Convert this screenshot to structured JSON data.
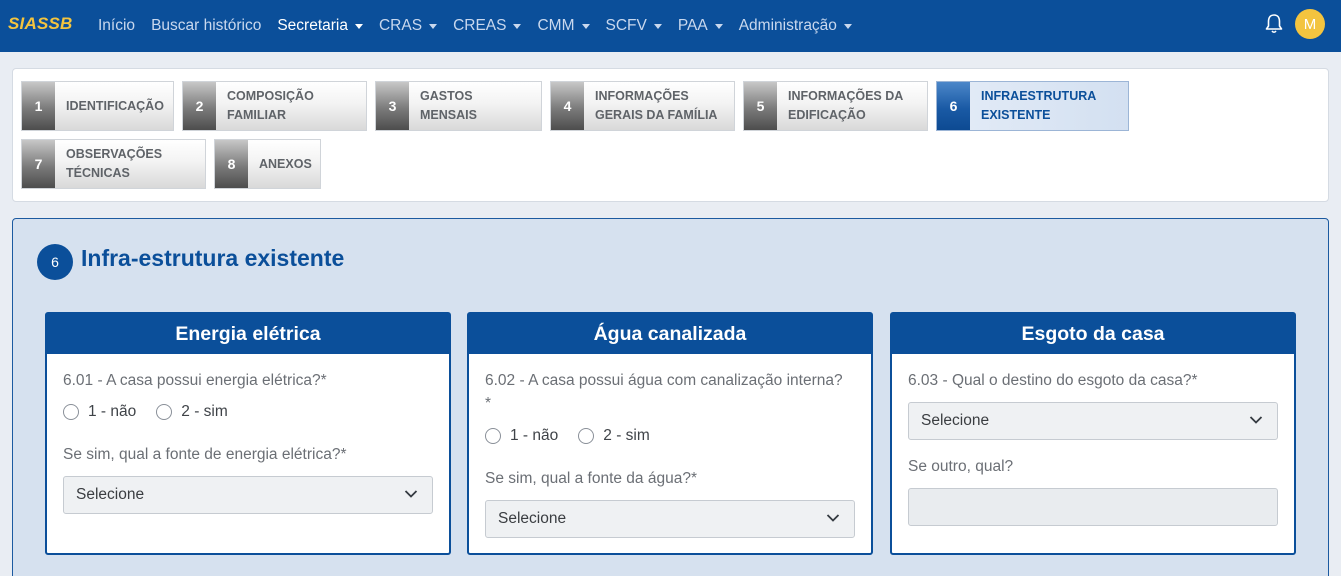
{
  "navbar": {
    "brand": "SIASSB",
    "items": [
      {
        "label": "Início",
        "dropdown": false,
        "active": false
      },
      {
        "label": "Buscar histórico",
        "dropdown": false,
        "active": false
      },
      {
        "label": "Secretaria",
        "dropdown": true,
        "active": true
      },
      {
        "label": "CRAS",
        "dropdown": true,
        "active": false
      },
      {
        "label": "CREAS",
        "dropdown": true,
        "active": false
      },
      {
        "label": "CMM",
        "dropdown": true,
        "active": false
      },
      {
        "label": "SCFV",
        "dropdown": true,
        "active": false
      },
      {
        "label": "PAA",
        "dropdown": true,
        "active": false
      },
      {
        "label": "Administração",
        "dropdown": true,
        "active": false
      }
    ],
    "avatar_initial": "M",
    "bell_icon": "bell-icon"
  },
  "steps": [
    {
      "num": "1",
      "label": "IDENTIFICAÇÃO",
      "active": false
    },
    {
      "num": "2",
      "label": "COMPOSIÇÃO FAMILIAR",
      "active": false
    },
    {
      "num": "3",
      "label": "GASTOS MENSAIS",
      "active": false
    },
    {
      "num": "4",
      "label": "INFORMAÇÕES GERAIS DA FAMÍLIA",
      "active": false
    },
    {
      "num": "5",
      "label": "INFORMAÇÕES DA EDIFICAÇÃO",
      "active": false
    },
    {
      "num": "6",
      "label": "INFRAESTRUTURA EXISTENTE",
      "active": true
    },
    {
      "num": "7",
      "label": "OBSERVAÇÕES TÉCNICAS",
      "active": false
    },
    {
      "num": "8",
      "label": "ANEXOS",
      "active": false
    }
  ],
  "section": {
    "badge": "6",
    "title": "Infra-estrutura existente"
  },
  "panels": {
    "energia": {
      "title": "Energia elétrica",
      "question": "6.01 - A casa possui energia elétrica?*",
      "option1": "1 - não",
      "option2": "2 - sim",
      "question2": "Se sim, qual a fonte de energia elétrica?*",
      "select_value": "Selecione"
    },
    "agua": {
      "title": "Água canalizada",
      "question_line1": "6.02 - A casa possui água com canalização interna?",
      "question_line2": "*",
      "option1": "1 - não",
      "option2": "2 - sim",
      "question2": "Se sim, qual a fonte da água?*",
      "select_value": "Selecione"
    },
    "esgoto": {
      "title": "Esgoto da casa",
      "question": "6.03 - Qual o destino do esgoto da casa?*",
      "select_value": "Selecione",
      "question2": "Se outro, qual?",
      "input_value": ""
    }
  },
  "colors": {
    "navbar": "#0b4f9a",
    "brand": "#f3c43f",
    "section_bg": "#d6e1ef"
  }
}
